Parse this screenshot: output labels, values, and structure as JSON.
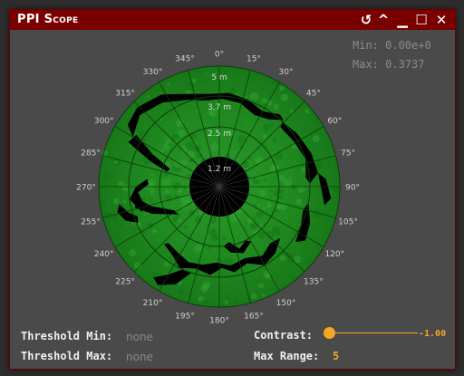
{
  "window": {
    "title": "PPI Scope",
    "buttons": {
      "reset": "↺",
      "collapse": "^",
      "minimize": "▁",
      "maximize": "☐",
      "close": "✕"
    }
  },
  "readouts": {
    "min": "Min: 0.00e+0",
    "max": "Max: 0.3737"
  },
  "scope": {
    "azimuth_labels": [
      "0°",
      "15°",
      "30°",
      "45°",
      "60°",
      "75°",
      "90°",
      "105°",
      "120°",
      "135°",
      "150°",
      "165°",
      "180°",
      "195°",
      "210°",
      "225°",
      "240°",
      "255°",
      "270°",
      "285°",
      "300°",
      "315°",
      "330°",
      "345°"
    ],
    "range_labels": [
      "5 m",
      "3.7 m",
      "2.5 m",
      "1.2 m"
    ],
    "colors": {
      "background": "#4a4a4a",
      "field": "#1e8a1e",
      "grid": "#0c3c0c",
      "echo": "#000000"
    }
  },
  "controls": {
    "threshold_min_label": "Threshold Min:",
    "threshold_min_value": "none",
    "threshold_max_label": "Threshold Max:",
    "threshold_max_value": "none",
    "contrast_label": "Contrast:",
    "contrast_value": "-1.00",
    "contrast_level": 0,
    "max_range_label": "Max Range:",
    "max_range_value": "5",
    "accent": "#f5a623"
  }
}
